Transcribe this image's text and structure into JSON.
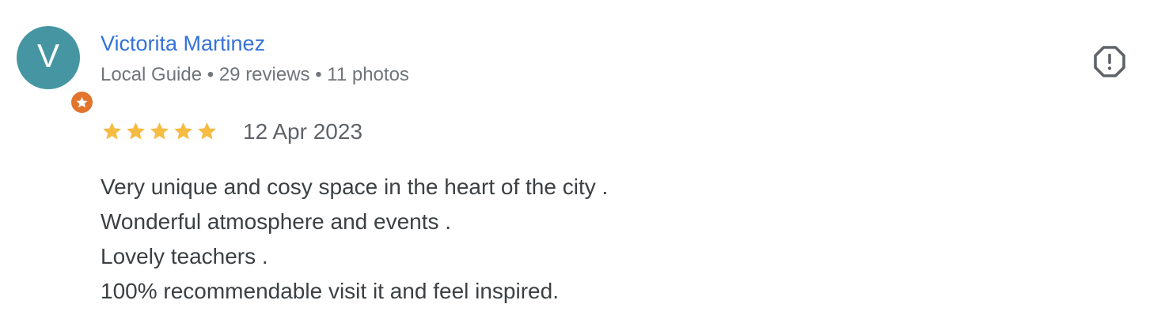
{
  "reviewer": {
    "initial": "V",
    "name": "Victorita Martinez",
    "meta": "Local Guide • 29 reviews • 11 photos",
    "avatar_color": "#4596a2",
    "badge_color": "#e3742e",
    "badge_icon": "star-icon"
  },
  "review": {
    "rating": 5,
    "rating_max": 5,
    "star_color": "#f6bb42",
    "date": "12 Apr 2023",
    "lines": [
      "Very unique and cosy space in the heart of the city .",
      "Wonderful atmosphere and events .",
      "Lovely teachers .",
      "100% recommendable visit it and feel inspired."
    ]
  },
  "actions": {
    "report_icon": "report-octagon-icon",
    "link_color": "#3572d8"
  }
}
